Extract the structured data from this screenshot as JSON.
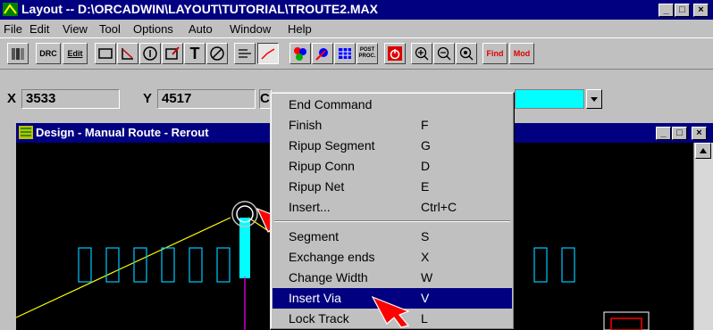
{
  "window": {
    "title": "Layout -- D:\\ORCADWIN\\LAYOUT\\TUTORIAL\\TROUTE2.MAX",
    "minimize": "_",
    "maximize": "□",
    "close": "×"
  },
  "menu": {
    "items": [
      {
        "label": "File",
        "key": "F"
      },
      {
        "label": "Edit",
        "key": "E"
      },
      {
        "label": "View",
        "key": "V"
      },
      {
        "label": "Tool",
        "key": "T"
      },
      {
        "label": "Options",
        "key": "O"
      },
      {
        "label": "Auto",
        "key": "A"
      },
      {
        "label": "Window",
        "key": "W"
      },
      {
        "label": "Help",
        "key": "H"
      }
    ]
  },
  "toolbar": {
    "drc": "DRC",
    "edit": "Edit",
    "text_tool": "T",
    "post_proc": "POST PROC.",
    "find": "Find",
    "mod": "Mod"
  },
  "coords": {
    "x_label": "X",
    "x_value": "3533",
    "y_label": "Y",
    "y_value": "4517",
    "extra_label": "C"
  },
  "colors": {
    "layer_swatch": "#00ffff",
    "track": "#00ffff",
    "ratsnest": "#ffff00",
    "selection": "#000080"
  },
  "design_window": {
    "title": "Design - Manual Route - Rerout"
  },
  "context_menu": {
    "group1": [
      {
        "label": "End Command",
        "shortcut": ""
      },
      {
        "label": "Finish",
        "shortcut": "F"
      },
      {
        "label": "Ripup Segment",
        "shortcut": "G"
      },
      {
        "label": "Ripup Conn",
        "shortcut": "D"
      },
      {
        "label": "Ripup Net",
        "shortcut": "E"
      },
      {
        "label": "Insert...",
        "shortcut": "Ctrl+C"
      }
    ],
    "group2": [
      {
        "label": "Segment",
        "shortcut": "S"
      },
      {
        "label": "Exchange ends",
        "shortcut": "X"
      },
      {
        "label": "Change Width",
        "shortcut": "W"
      },
      {
        "label": "Insert Via",
        "shortcut": "V"
      },
      {
        "label": "Lock Track",
        "shortcut": "L"
      }
    ],
    "selected": "Insert Via"
  }
}
